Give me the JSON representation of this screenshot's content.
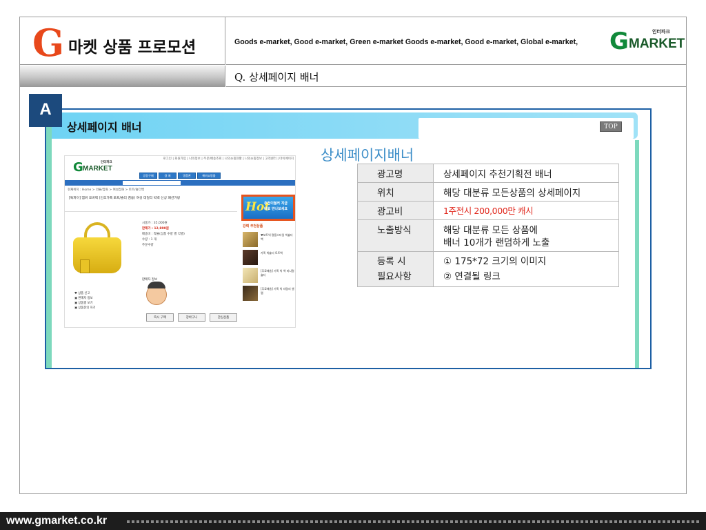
{
  "header": {
    "title_letter": "G",
    "title_text": "마켓 상품 프로모션",
    "slogan": "Goods e-market, Good e-market, Green e-market Goods e-market, Good e-market, Global e-market,",
    "logo": {
      "top_small": "인터파크",
      "g": "G",
      "text": "MARKET"
    },
    "question": "Q. 상세페이지 배너"
  },
  "badge": "A",
  "panel": {
    "title": "상세페이지 배너",
    "top_button": "TOP"
  },
  "mini_screenshot": {
    "topbar": "로그인 | 회원가입 | 나의정보 | 주문/배송조회 | 나의쇼핑현황 | 나의쇼핑정보 | 고객센터 | 마이페이지",
    "logo_small": "인터파크",
    "logo_g": "G",
    "logo_text": "MARKET",
    "nav": [
      "공동구매",
      "경 매",
      "명품관",
      "해외쇼핑몰"
    ],
    "crumb": "현재위치 : Home > 의류/잡화 > 여성잡화 > 토트/숄더백",
    "product_title": "[특파이] 엠버 오버백 (인조가죽 토트/숄더 겸용) 여성 데일리 빅백 신상 패션가방",
    "hot_text": "Hot",
    "hot_sub": "추천이월러 지금 바로 만나보세요",
    "info_lines": [
      "시중가 : 35,000원",
      "판매가 : 12,800원",
      "배송비 : 착불(상품 수량 별 각별)",
      "수량 : 1 개",
      "주문수량"
    ],
    "recommend_head": "강력 추천상품",
    "thumbs": [
      "♥보트넥 명품스타일 빅숄더백",
      "가죽 빅숄더 토트백",
      "[무료배송] 가죽 빅 백 미니멀 숄더",
      "[무료배송] 가죽 빅 데일리 셀렙"
    ],
    "seller": "판매자 정보",
    "tiny_links": [
      "♥ 상품 신고",
      "▣ 판매자 정보",
      "▣ 상품평 보기",
      "▣ 상품문의 하기"
    ],
    "bottom_buttons": [
      "즉시 구매",
      "장바구니",
      "관심상품"
    ]
  },
  "spec": {
    "title": "상세페이지배너",
    "rows": [
      {
        "key": "광고명",
        "value": "상세페이지 추천기획전 배너"
      },
      {
        "key": "위치",
        "value": "해당 대분류 모든상품의 상세페이지"
      },
      {
        "key": "광고비",
        "value": "1주전시 200,000만 캐시"
      },
      {
        "key": "노출방식",
        "value": "해당 대분류 모든 상품에\n배너 10개가 랜덤하게 노출"
      },
      {
        "key": "등록 시\n필요사항",
        "value": "① 175*72 크기의 이미지\n② 연결될 링크"
      }
    ]
  },
  "footer": {
    "url": "www.gmarket.co.kr"
  },
  "colors": {
    "accent_orange": "#e8481b",
    "badge_blue": "#1c4a7d",
    "panel_border": "#1c5fa4",
    "header_cyan": "#6fd3f4",
    "spec_title_blue": "#3d8ec8",
    "price_red": "#e0251a",
    "logo_green": "#11893a"
  }
}
